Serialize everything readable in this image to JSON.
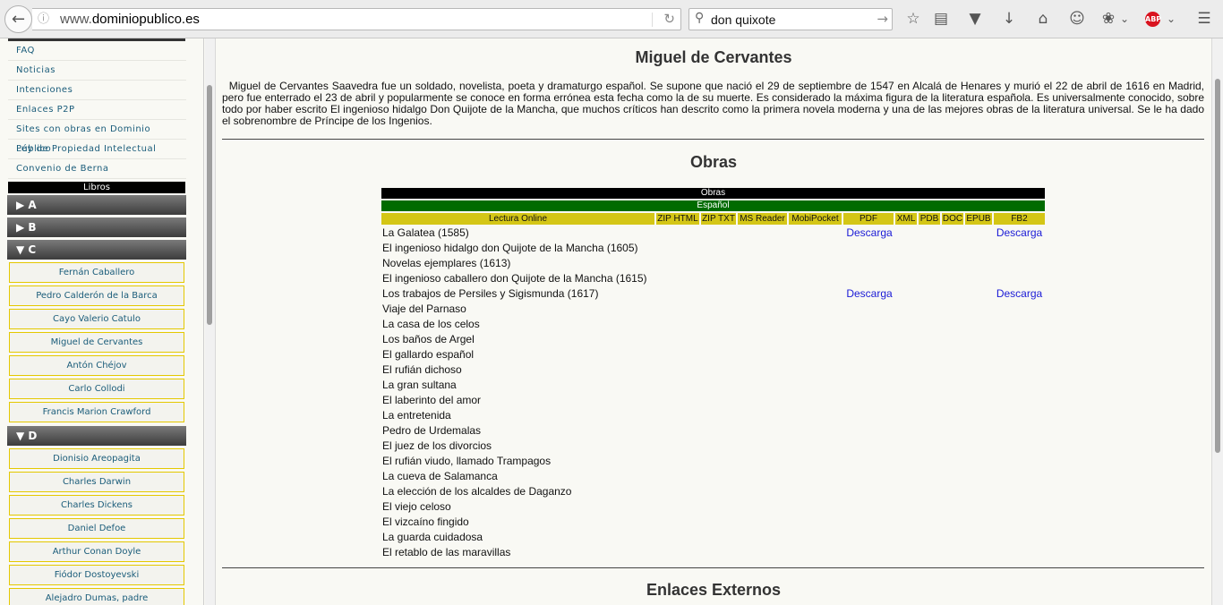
{
  "browser": {
    "url_prefix": "www.",
    "url_domain": "dominiopublico.es",
    "search_query": "don quixote",
    "abp_label": "ABP"
  },
  "sidebar": {
    "links": [
      "FAQ",
      "Noticias",
      "Intenciones",
      "Enlaces P2P",
      "Sites con obras en Dominio Público",
      "Ley de Propiedad Intelectual",
      "Convenio de Berna"
    ],
    "section_title": "Libros",
    "categories": [
      "▶ A",
      "▶ B",
      "▼ C",
      "▼ D"
    ],
    "authors_c": [
      "Fernán Caballero",
      "Pedro Calderón de la Barca",
      "Cayo Valerio Catulo",
      "Miguel de Cervantes",
      "Antón Chéjov",
      "Carlo Collodi",
      "Francis Marion Crawford"
    ],
    "authors_d": [
      "Dionisio Areopagita",
      "Charles Darwin",
      "Charles Dickens",
      "Daniel Defoe",
      "Arthur Conan Doyle",
      "Fiódor Dostoyevski",
      "Alejadro Dumas, padre"
    ]
  },
  "main": {
    "title": "Miguel de Cervantes",
    "bio": "Miguel de Cervantes Saavedra fue un soldado, novelista, poeta y dramaturgo español. Se supone que nació el 29 de septiembre de 1547 en Alcalá de Henares y murió el 22 de abril de 1616 en Madrid, pero fue enterrado el 23 de abril y popularmente se conoce en forma errónea esta fecha como la de su muerte. Es considerado la máxima figura de la literatura española. Es universalmente conocido, sobre todo por haber escrito El ingenioso hidalgo Don Quijote de la Mancha, que muchos críticos han descrito como la primera novela moderna y una de las mejores obras de la literatura universal. Se le ha dado el sobrenombre de Príncipe de los Ingenios.",
    "obras_heading": "Obras",
    "table": {
      "title": "Obras",
      "language": "Español",
      "columns": [
        "Lectura Online",
        "ZIP HTML",
        "ZIP TXT",
        "MS Reader",
        "MobiPocket",
        "PDF",
        "XML",
        "PDB",
        "DOC",
        "EPUB",
        "FB2"
      ],
      "download_label": "Descarga",
      "works": [
        {
          "title": "La Galatea (1585)",
          "pdf": "Descarga",
          "fb2": "Descarga"
        },
        {
          "title": "El ingenioso hidalgo don Quijote de la Mancha (1605)",
          "pdf": "",
          "fb2": ""
        },
        {
          "title": "Novelas ejemplares (1613)",
          "pdf": "",
          "fb2": ""
        },
        {
          "title": "El ingenioso caballero don Quijote de la Mancha (1615)",
          "pdf": "",
          "fb2": ""
        },
        {
          "title": "Los trabajos de Persiles y Sigismunda (1617)",
          "pdf": "Descarga",
          "fb2": "Descarga"
        },
        {
          "title": "Viaje del Parnaso",
          "pdf": "",
          "fb2": ""
        },
        {
          "title": "La casa de los celos",
          "pdf": "",
          "fb2": ""
        },
        {
          "title": "Los baños de Argel",
          "pdf": "",
          "fb2": ""
        },
        {
          "title": "El gallardo español",
          "pdf": "",
          "fb2": ""
        },
        {
          "title": "El rufián dichoso",
          "pdf": "",
          "fb2": ""
        },
        {
          "title": "La gran sultana",
          "pdf": "",
          "fb2": ""
        },
        {
          "title": "El laberinto del amor",
          "pdf": "",
          "fb2": ""
        },
        {
          "title": "La entretenida",
          "pdf": "",
          "fb2": ""
        },
        {
          "title": "Pedro de Urdemalas",
          "pdf": "",
          "fb2": ""
        },
        {
          "title": "El juez de los divorcios",
          "pdf": "",
          "fb2": ""
        },
        {
          "title": "El rufián viudo, llamado Trampagos",
          "pdf": "",
          "fb2": ""
        },
        {
          "title": "La cueva de Salamanca",
          "pdf": "",
          "fb2": ""
        },
        {
          "title": "La elección de los alcaldes de Daganzo",
          "pdf": "",
          "fb2": ""
        },
        {
          "title": "El viejo celoso",
          "pdf": "",
          "fb2": ""
        },
        {
          "title": "El vizcaíno fingido",
          "pdf": "",
          "fb2": ""
        },
        {
          "title": "La guarda cuidadosa",
          "pdf": "",
          "fb2": ""
        },
        {
          "title": "El retablo de las maravillas",
          "pdf": "",
          "fb2": ""
        }
      ]
    },
    "external_heading": "Enlaces Externos"
  },
  "colors": {
    "obras_bar": "#000000",
    "language_bar": "#006b00",
    "column_header": "#d4c616",
    "link": "#1a1ad6",
    "author_border": "#e4c800"
  }
}
